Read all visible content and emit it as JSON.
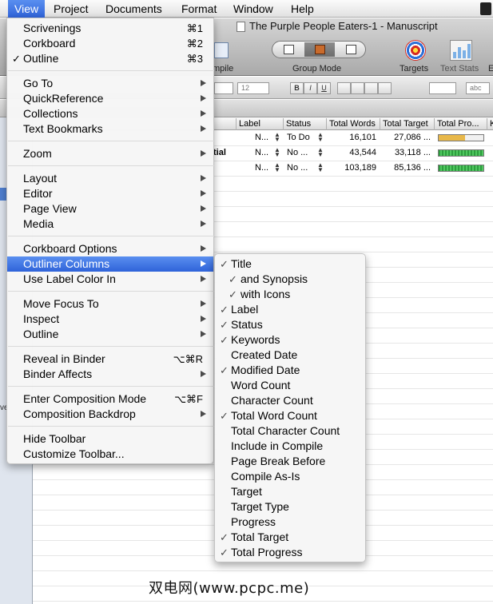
{
  "menubar": {
    "items": [
      "View",
      "Project",
      "Documents",
      "Format",
      "Window",
      "Help"
    ],
    "active": "View"
  },
  "toolbar": {
    "document_title": "The Purple People Eaters-1 - Manuscript",
    "compile_label": "mpile",
    "group_mode_label": "Group Mode",
    "targets_label": "Targets",
    "text_stats_label": "Text Stats",
    "edge_label": "E"
  },
  "formatbar": {
    "font_size": "12",
    "bold": "B",
    "italic": "I",
    "underline": "U",
    "style_picker": "abc"
  },
  "outliner": {
    "columns": [
      "Label",
      "Status",
      "Total Words",
      "Total Target",
      "Total Pro...",
      "K"
    ],
    "rows": [
      {
        "title_tail": "",
        "label": "N...",
        "status": "To Do",
        "total_words": "16,101",
        "total_target": "27,086 ...",
        "progress": 0.59,
        "bar": "amber"
      },
      {
        "title_tail": "tial",
        "label": "N...",
        "status": "No ...",
        "total_words": "43,544",
        "total_target": "33,118 ...",
        "progress": 1.0,
        "bar": "green"
      },
      {
        "title_tail": "",
        "label": "N...",
        "status": "No ...",
        "total_words": "103,189",
        "total_target": "85,136 ...",
        "progress": 1.0,
        "bar": "green"
      }
    ]
  },
  "binder": {
    "partial_text": "ve"
  },
  "view_menu": {
    "groups": [
      [
        {
          "label": "Scrivenings",
          "shortcut": "⌘1"
        },
        {
          "label": "Corkboard",
          "shortcut": "⌘2"
        },
        {
          "label": "Outline",
          "shortcut": "⌘3",
          "checked": true
        }
      ],
      [
        {
          "label": "Go To",
          "submenu": true
        },
        {
          "label": "QuickReference",
          "submenu": true
        },
        {
          "label": "Collections",
          "submenu": true
        },
        {
          "label": "Text Bookmarks",
          "submenu": true
        }
      ],
      [
        {
          "label": "Zoom",
          "submenu": true
        }
      ],
      [
        {
          "label": "Layout",
          "submenu": true
        },
        {
          "label": "Editor",
          "submenu": true
        },
        {
          "label": "Page View",
          "submenu": true
        },
        {
          "label": "Media",
          "submenu": true
        }
      ],
      [
        {
          "label": "Corkboard Options",
          "submenu": true
        },
        {
          "label": "Outliner Columns",
          "submenu": true,
          "highlighted": true
        },
        {
          "label": "Use Label Color In",
          "submenu": true
        }
      ],
      [
        {
          "label": "Move Focus To",
          "submenu": true
        },
        {
          "label": "Inspect",
          "submenu": true
        },
        {
          "label": "Outline",
          "submenu": true
        }
      ],
      [
        {
          "label": "Reveal in Binder",
          "shortcut": "⌥⌘R"
        },
        {
          "label": "Binder Affects",
          "submenu": true
        }
      ],
      [
        {
          "label": "Enter Composition Mode",
          "shortcut": "⌥⌘F"
        },
        {
          "label": "Composition Backdrop",
          "submenu": true
        }
      ],
      [
        {
          "label": "Hide Toolbar"
        },
        {
          "label": "Customize Toolbar..."
        }
      ]
    ]
  },
  "outliner_columns_menu": {
    "items": [
      {
        "label": "Title",
        "checked": true
      },
      {
        "label": "and Synopsis",
        "checked": true,
        "indent": true
      },
      {
        "label": "with Icons",
        "checked": true,
        "indent": true
      },
      {
        "label": "Label",
        "checked": true
      },
      {
        "label": "Status",
        "checked": true
      },
      {
        "label": "Keywords",
        "checked": true
      },
      {
        "label": "Created Date",
        "checked": false
      },
      {
        "label": "Modified Date",
        "checked": true
      },
      {
        "label": "Word Count",
        "checked": false
      },
      {
        "label": "Character Count",
        "checked": false
      },
      {
        "label": "Total Word Count",
        "checked": true
      },
      {
        "label": "Total Character Count",
        "checked": false
      },
      {
        "label": "Include in Compile",
        "checked": false
      },
      {
        "label": "Page Break Before",
        "checked": false
      },
      {
        "label": "Compile As-Is",
        "checked": false
      },
      {
        "label": "Target",
        "checked": false
      },
      {
        "label": "Target Type",
        "checked": false
      },
      {
        "label": "Progress",
        "checked": false
      },
      {
        "label": "Total Target",
        "checked": true
      },
      {
        "label": "Total Progress",
        "checked": true
      }
    ]
  },
  "watermark": "双电网(www.pcpc.me)",
  "colors": {
    "highlight": "#2f63d9",
    "progress_green": "#2e9d3f",
    "progress_amber": "#e8b84a"
  }
}
